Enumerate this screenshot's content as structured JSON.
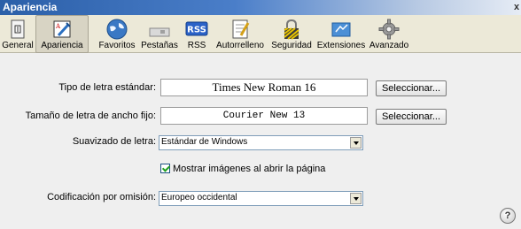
{
  "window": {
    "title": "Apariencia",
    "close_glyph": "x"
  },
  "toolbar": {
    "items": [
      {
        "label": "General",
        "icon": "general-icon"
      },
      {
        "label": "Apariencia",
        "icon": "appearance-icon",
        "selected": true
      },
      {
        "label": "Favoritos",
        "icon": "favorites-globe-icon"
      },
      {
        "label": "Pestañas",
        "icon": "tabs-icon"
      },
      {
        "label": "RSS",
        "icon": "rss-icon",
        "badge": "RSS"
      },
      {
        "label": "Autorrelleno",
        "icon": "autofill-icon"
      },
      {
        "label": "Seguridad",
        "icon": "lock-icon"
      },
      {
        "label": "Extensiones",
        "icon": "extensions-icon"
      },
      {
        "label": "Avanzado",
        "icon": "gear-icon"
      }
    ]
  },
  "form": {
    "standard_font": {
      "label": "Tipo de letra estándar:",
      "value": "Times New Roman 16",
      "button": "Seleccionar..."
    },
    "fixed_font": {
      "label": "Tamaño de letra de ancho fijo:",
      "value": "Courier New 13",
      "button": "Seleccionar..."
    },
    "smoothing": {
      "label": "Suavizado de letra:",
      "value": "Estándar de Windows"
    },
    "show_images": {
      "label": "Mostrar imágenes al abrir la página",
      "checked": true
    },
    "encoding": {
      "label": "Codificación por omisión:",
      "value": "Europeo occidental"
    }
  },
  "help": {
    "glyph": "?"
  },
  "colors": {
    "title_bar": "#2b5fa8",
    "checkmark": "#21a121",
    "select_border": "#7f9db9"
  }
}
